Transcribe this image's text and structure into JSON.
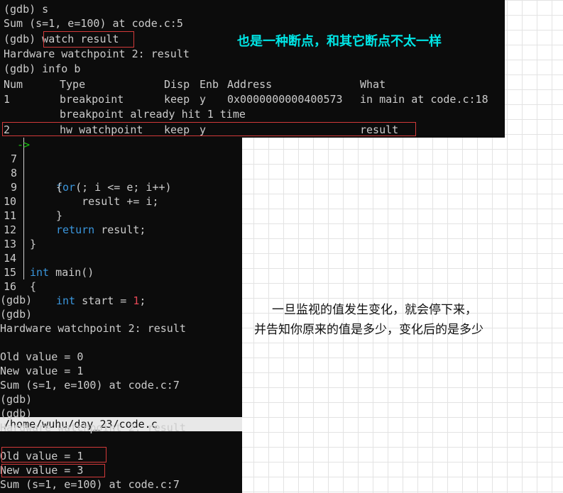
{
  "top_terminal": {
    "lines": [
      "(gdb) s",
      "Sum (s=1, e=100) at code.c:5",
      "(gdb) watch result",
      "Hardware watchpoint 2: result",
      "(gdb) info b"
    ],
    "table": {
      "headers": {
        "num": "Num",
        "type": "Type",
        "disp": "Disp",
        "enb": "Enb",
        "address": "Address",
        "what": "What"
      },
      "rows": [
        {
          "num": "1",
          "type": "breakpoint",
          "disp": "keep",
          "enb": "y",
          "address": "0x0000000000400573",
          "what": "in main at code.c:18"
        },
        {
          "num": "",
          "type": "breakpoint already hit 1 time",
          "disp": "",
          "enb": "",
          "address": "",
          "what": ""
        },
        {
          "num": "2",
          "type": "hw watchpoint",
          "disp": "keep",
          "enb": "y",
          "address": "",
          "what": "result"
        }
      ]
    }
  },
  "source": {
    "lines": [
      {
        "n": "7",
        "arrow": "->",
        "code": "for(; i <= e; i++)"
      },
      {
        "n": "8",
        "code": "{"
      },
      {
        "n": "9",
        "code": "    result += i;"
      },
      {
        "n": "10",
        "code": "}"
      },
      {
        "n": "11",
        "code": "return result;"
      },
      {
        "n": "12",
        "code": "}"
      },
      {
        "n": "13",
        "code": ""
      },
      {
        "n": "14",
        "code": "int main()"
      },
      {
        "n": "15",
        "code": "{"
      },
      {
        "n": "16",
        "code": "    int start = 1;"
      }
    ],
    "file_path": "/home/wuhu/day_23/code.c"
  },
  "bottom_terminal": {
    "lines": [
      "(gdb)",
      "(gdb)",
      "Hardware watchpoint 2: result",
      "",
      "Old value = 0",
      "New value = 1",
      "Sum (s=1, e=100) at code.c:7",
      "(gdb)",
      "(gdb)",
      "Hardware watchpoint 2: result",
      "",
      "Old value = 1",
      "New value = 3",
      "Sum (s=1, e=100) at code.c:7"
    ]
  },
  "annotations": {
    "watch_note": "也是一种断点，和其它断点不太一样",
    "change_note_line1": "一旦监视的值发生变化，就会停下来，",
    "change_note_line2": "并告知你原来的值是多少，变化后的是多少"
  },
  "colors": {
    "terminal_bg": "#0c0c0c",
    "terminal_fg": "#cccccc",
    "keyword": "#3a96dd",
    "number": "#e74856",
    "arrow": "#16c60c",
    "highlight_box": "#d23a3a",
    "note_cyan": "#00e5e5"
  }
}
